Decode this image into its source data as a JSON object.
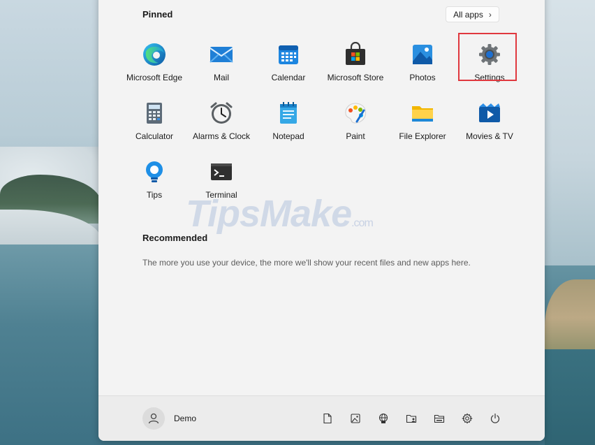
{
  "start_menu": {
    "pinned_title": "Pinned",
    "all_apps_label": "All apps",
    "pinned_apps": [
      {
        "label": "Microsoft Edge",
        "icon": "edge-icon"
      },
      {
        "label": "Mail",
        "icon": "mail-icon"
      },
      {
        "label": "Calendar",
        "icon": "calendar-icon"
      },
      {
        "label": "Microsoft Store",
        "icon": "store-icon"
      },
      {
        "label": "Photos",
        "icon": "photos-icon"
      },
      {
        "label": "Settings",
        "icon": "gear-icon"
      },
      {
        "label": "Calculator",
        "icon": "calculator-icon"
      },
      {
        "label": "Alarms & Clock",
        "icon": "clock-icon"
      },
      {
        "label": "Notepad",
        "icon": "notepad-icon"
      },
      {
        "label": "Paint",
        "icon": "palette-icon"
      },
      {
        "label": "File Explorer",
        "icon": "folder-icon"
      },
      {
        "label": "Movies & TV",
        "icon": "movie-icon"
      },
      {
        "label": "Tips",
        "icon": "lightbulb-icon"
      },
      {
        "label": "Terminal",
        "icon": "terminal-icon"
      }
    ],
    "recommended_title": "Recommended",
    "recommended_text": "The more you use your device, the more we'll show your recent files and new apps here."
  },
  "watermark": {
    "brand": "TipsMake",
    "suffix": ".com"
  },
  "footer": {
    "user_name": "Demo",
    "icons": [
      "document-icon",
      "pictures-icon",
      "network-icon",
      "personal-folder-icon",
      "file-explorer-icon",
      "settings-icon",
      "power-icon"
    ]
  },
  "colors": {
    "highlight": "#e0383e",
    "accent": "#0a6cc9"
  }
}
